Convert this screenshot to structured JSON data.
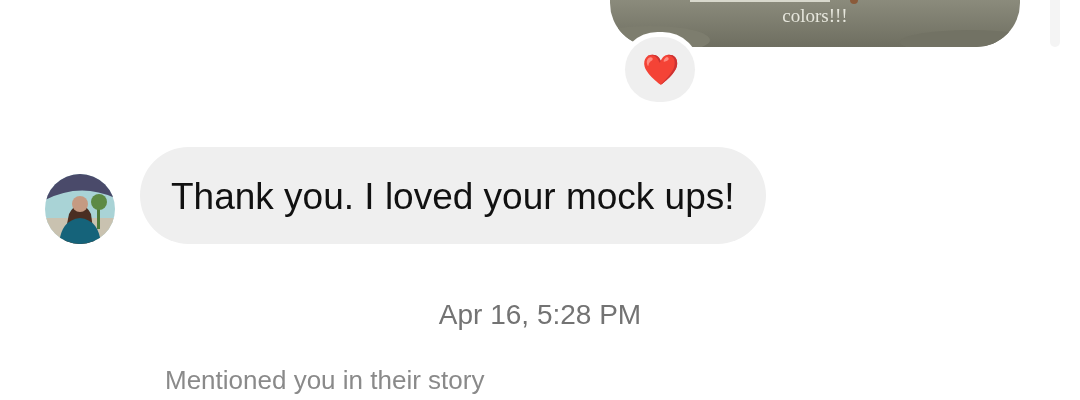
{
  "story_reply": {
    "kind": "picture",
    "caption": "colors!!!",
    "reaction": "❤️"
  },
  "messages": [
    {
      "kind": "received",
      "text": "Thank you. I loved your mock ups!"
    }
  ],
  "timestamp": "Apr 16, 5:28 PM",
  "next_message": {
    "text": "Mentioned you in their story"
  }
}
